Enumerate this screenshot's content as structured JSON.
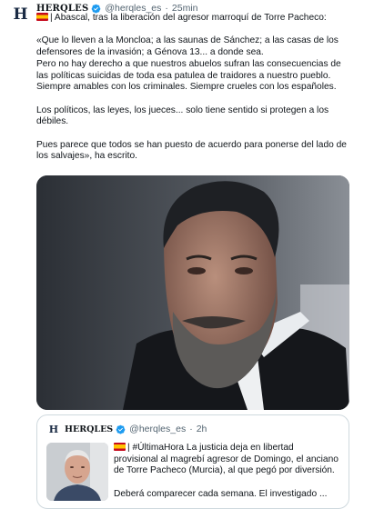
{
  "tweet": {
    "author": {
      "avatar_text": "H",
      "name": "HERQLES",
      "handle": "@herqles_es",
      "separator": "·",
      "time": "25min"
    },
    "lines": [
      "| Abascal, tras la liberación del agresor marroquí de Torre Pacheco:",
      "",
      "«Que lo lleven a la Moncloa; a las saunas de Sánchez; a las casas de los",
      "defensores de la invasión; a Génova 13... a donde sea.",
      "Pero no hay derecho a que nuestros abuelos sufran las consecuencias de",
      "las políticas suicidas de toda esa patulea de traidores a nuestro pueblo.",
      "Siempre amables con los criminales. Siempre crueles con los españoles.",
      "",
      "Los políticos, las leyes, los jueces... solo tiene sentido si protegen a los",
      "débiles.",
      "",
      "Pues parece que todos se han puesto de acuerdo para ponerse del lado de",
      "los salvajes», ha escrito."
    ],
    "flag_icon": "spain-flag-icon"
  },
  "quoted": {
    "author": {
      "avatar_text": "H",
      "name": "HERQLES",
      "handle": "@herqles_es",
      "separator": "·",
      "time": "2h"
    },
    "lines": [
      "| #ÚltimaHora La justicia deja en libertad",
      "provisional al magrebí agresor de Domingo, el anciano",
      "de Torre Pacheco (Murcia), al que pegó por diversión.",
      "",
      "Deberá comparecer cada semana. El investigado ..."
    ]
  },
  "colors": {
    "text": "#0f1419",
    "muted": "#536471",
    "verified": "#1d9bf0",
    "border": "#cfd9de"
  }
}
